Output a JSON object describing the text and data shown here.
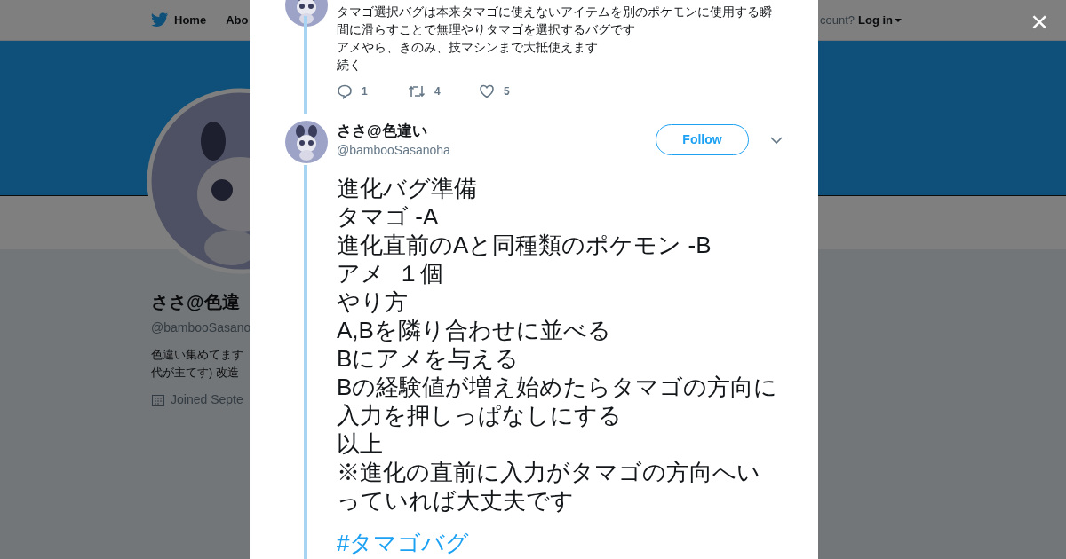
{
  "background_page": {
    "nav": {
      "items": [
        "Home",
        "Abo"
      ],
      "account_prompt": "count?",
      "login": "Log in"
    },
    "profile": {
      "name": "ささ@色違",
      "handle": "@bambooSasano",
      "bio_lines": [
        "色違い集めてます",
        "代が主てす) 改造"
      ],
      "joined": "Joined Septe"
    }
  },
  "modal": {
    "close": "×",
    "previous_tweet": {
      "lines": [
        "タマゴ選択バグは本来タマゴに使えないアイテムを別のポケモンに使用する瞬間に滑らすことで無理やりタマゴを選択するバグです",
        "アメやら、きのみ、技マシンまで大抵使えます",
        "続く"
      ],
      "actions": [
        {
          "kind": "reply",
          "count": "1"
        },
        {
          "kind": "retweet",
          "count": "4"
        },
        {
          "kind": "like",
          "count": "5"
        }
      ]
    },
    "tweet": {
      "name": "ささ@色違い",
      "handle": "@bambooSasanoha",
      "follow": "Follow",
      "lines": [
        "進化バグ準備",
        "タマゴ -A",
        "進化直前のAと同種類のポケモン -B",
        "アメ  １個",
        "やり方",
        "A,Bを隣り合わせに並べる",
        "Bにアメを与える",
        "Bの経験値が増え始めたらタマゴの方向に入力を押しっぱなしにする",
        "以上",
        "※進化の直前に入力がタマゴの方向へいっていれば大丈夫です"
      ],
      "hashtag": "#タマゴバグ"
    }
  }
}
